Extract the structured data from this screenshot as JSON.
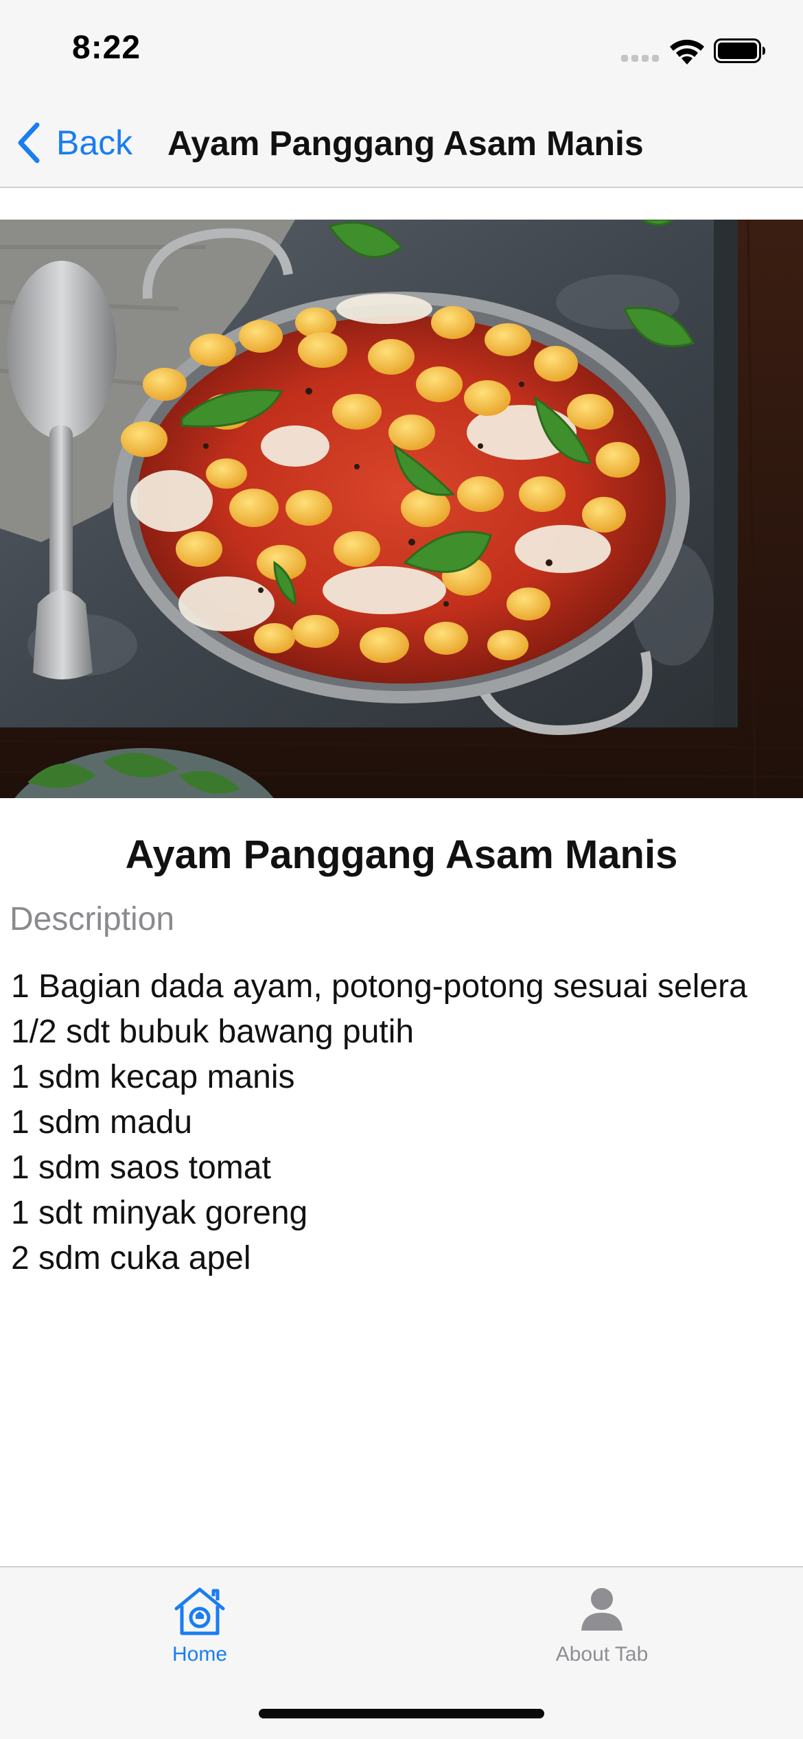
{
  "status_bar": {
    "time": "8:22"
  },
  "nav": {
    "back_label": "Back",
    "title": "Ayam Panggang Asam Manis",
    "accent_color": "#1a7df1"
  },
  "hero_image": {
    "subject": "dish-photo"
  },
  "recipe": {
    "title": "Ayam Panggang Asam Manis",
    "description_label": "Description",
    "ingredients": [
      "1 Bagian dada ayam, potong-potong sesuai selera",
      "1/2 sdt bubuk bawang putih",
      "1 sdm kecap manis",
      "1 sdm madu",
      "1 sdm saos tomat",
      "1 sdt minyak goreng",
      "2 sdm cuka apel"
    ]
  },
  "tabs": [
    {
      "label": "Home",
      "icon": "home-icon",
      "selected": true
    },
    {
      "label": "About Tab",
      "icon": "person-icon",
      "selected": false
    }
  ]
}
